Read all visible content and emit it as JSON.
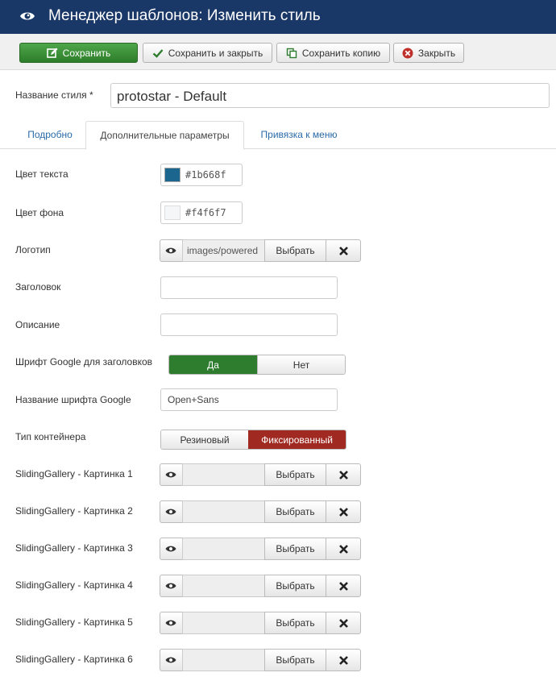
{
  "header": {
    "title": "Менеджер шаблонов: Изменить стиль",
    "icon": "eye-icon"
  },
  "toolbar": {
    "save": "Сохранить",
    "save_close": "Сохранить и закрыть",
    "save_copy": "Сохранить копию",
    "close": "Закрыть"
  },
  "style_name": {
    "label": "Название стиля *",
    "value": "protostar - Default"
  },
  "tabs": [
    "Подробно",
    "Дополнительные параметры",
    "Привязка к меню"
  ],
  "fields": {
    "text_color": {
      "label": "Цвет текста",
      "value": "#1b668f"
    },
    "bg_color": {
      "label": "Цвет фона",
      "value": "#f4f6f7"
    },
    "logo": {
      "label": "Логотип",
      "value": "images/powered"
    },
    "title": {
      "label": "Заголовок",
      "value": ""
    },
    "description": {
      "label": "Описание",
      "value": ""
    },
    "google_font": {
      "label": "Шрифт Google для заголовков",
      "yes": "Да",
      "no": "Нет",
      "selected": "Да"
    },
    "google_font_name": {
      "label": "Название шрифта Google",
      "value": "Open+Sans"
    },
    "container": {
      "label": "Тип контейнера",
      "fluid": "Резиновый",
      "fixed": "Фиксированный",
      "selected": "Фиксированный"
    }
  },
  "media_buttons": {
    "select": "Выбрать"
  },
  "gallery": [
    {
      "label": "SlidingGallery - Картинка 1",
      "value": ""
    },
    {
      "label": "SlidingGallery - Картинка 2",
      "value": ""
    },
    {
      "label": "SlidingGallery - Картинка 3",
      "value": ""
    },
    {
      "label": "SlidingGallery - Картинка 4",
      "value": ""
    },
    {
      "label": "SlidingGallery - Картинка 5",
      "value": ""
    },
    {
      "label": "SlidingGallery - Картинка 6",
      "value": ""
    }
  ],
  "colors": {
    "header_bg": "#1a3867",
    "save_green": "#2e7d2e",
    "fixed_red": "#a02a22",
    "link_blue": "#2a6aa8"
  }
}
